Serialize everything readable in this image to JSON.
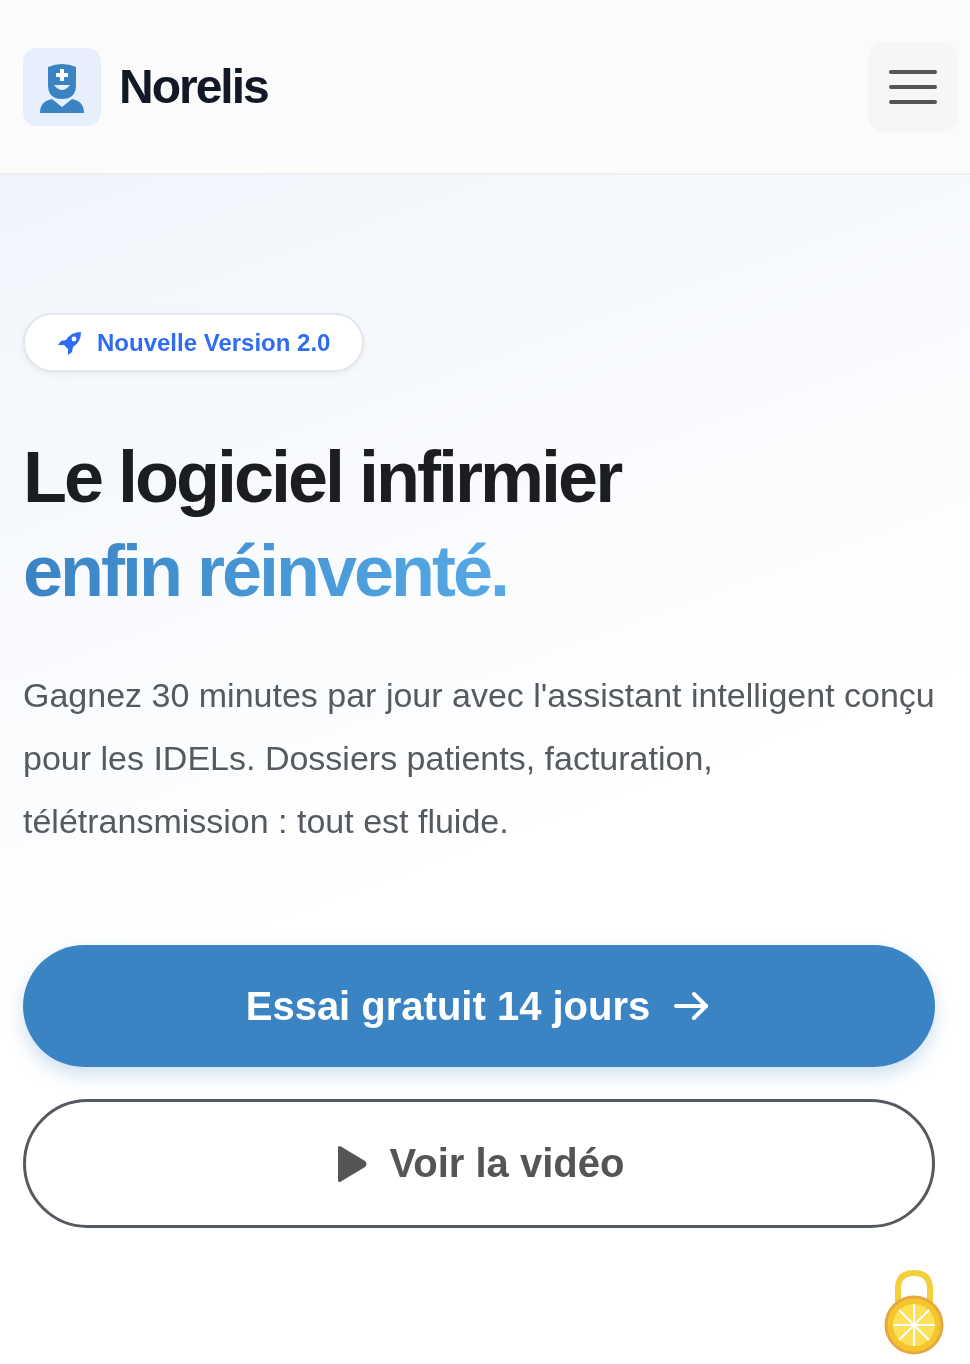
{
  "header": {
    "brand": "Norelis"
  },
  "badge": {
    "label": "Nouvelle Version 2.0"
  },
  "headline": {
    "text": "Le logiciel infirmier",
    "highlight": "enfin réinventé."
  },
  "intro": "Gagnez 30 minutes par jour avec l'assistant intelligent conçu pour les IDELs. Dossiers patients, facturation, télétransmission : tout est fluide.",
  "buttons": [
    {
      "kind": "primary",
      "label": "Essai gratuit 14 jours"
    },
    {
      "kind": "secondary",
      "label": "Voir la vidéo"
    }
  ]
}
